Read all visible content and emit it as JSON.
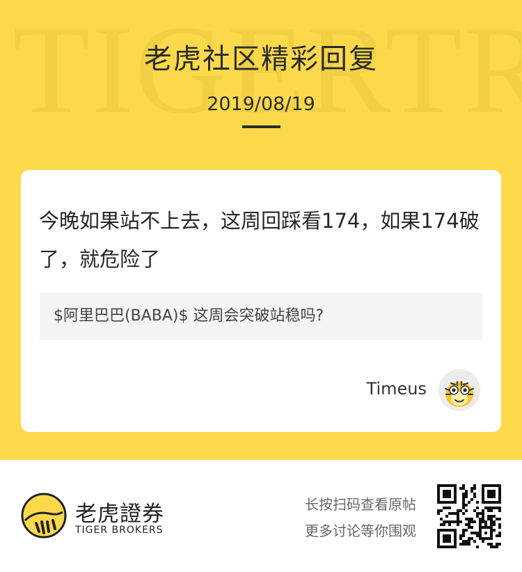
{
  "header": {
    "watermark": "TIGERTRAI",
    "title": "老虎社区精彩回复",
    "date": "2019/08/19"
  },
  "card": {
    "reply_text": "今晚如果站不上去，这周回踩看174，如果174破了，就危险了",
    "topic": "$阿里巴巴(BABA)$ 这周会突破站稳吗?",
    "author": "Timeus"
  },
  "footer": {
    "brand_cn": "老虎證券",
    "brand_en": "TIGER BROKERS",
    "hint_line1": "长按扫码查看原帖",
    "hint_line2": "更多讨论等你围观"
  },
  "colors": {
    "header_bg": "#fcd94b",
    "brand_yellow": "#fcd94b",
    "text_dark": "#2b2b2b"
  },
  "icons": {
    "avatar": "tiger-avatar-icon",
    "logo": "tiger-logo-icon",
    "qr": "qr-code"
  }
}
